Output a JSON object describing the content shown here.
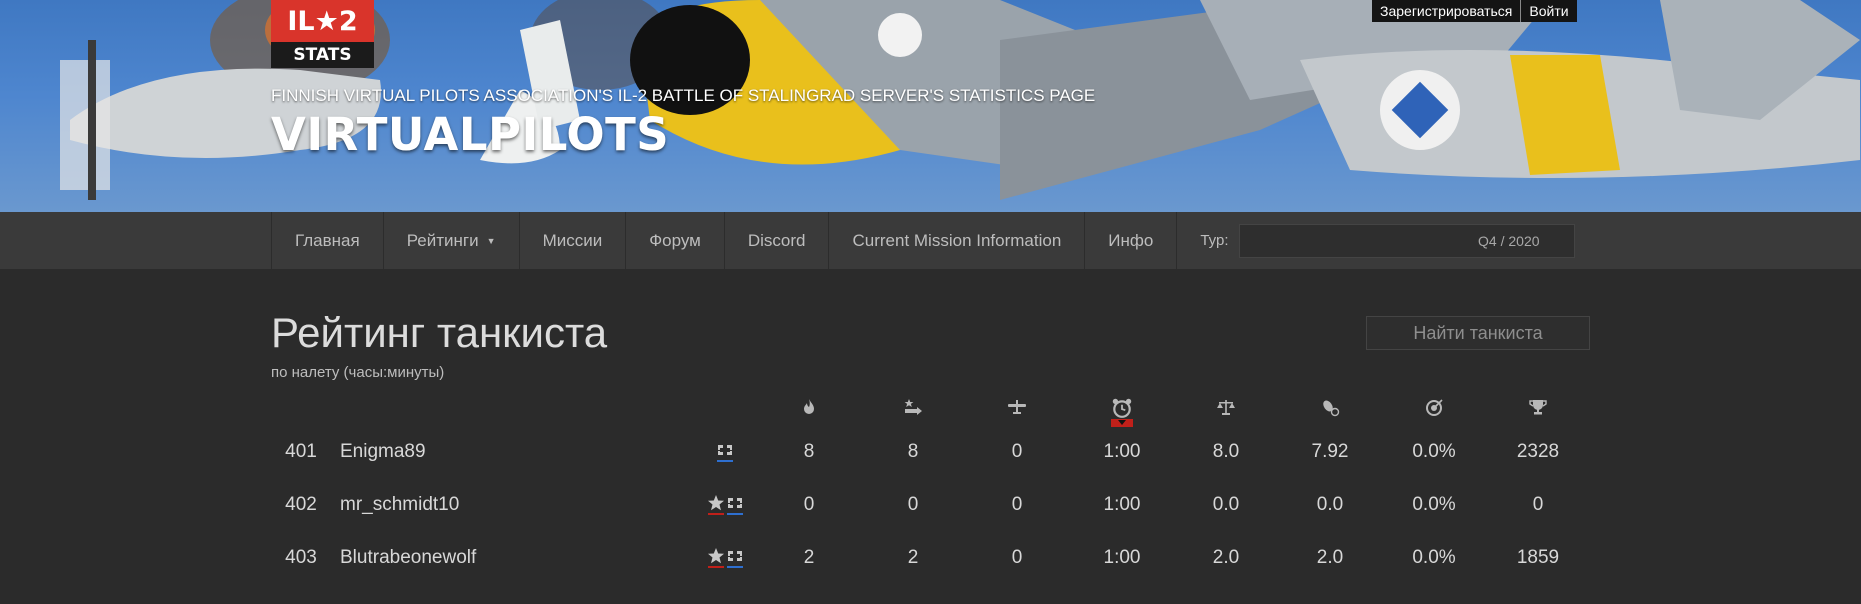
{
  "logo": {
    "line1": "IL★2",
    "line2": "STATS"
  },
  "banner": {
    "subtitle": "FINNISH VIRTUAL PILOTS ASSOCIATION'S IL-2 BATTLE OF STALINGRAD SERVER'S STATISTICS PAGE",
    "title": "VIRTUALPILOTS"
  },
  "auth": {
    "register": "Зарегистрироваться",
    "login": "Войти"
  },
  "nav": {
    "items": [
      "Главная",
      "Рейтинги",
      "Миссии",
      "Форум",
      "Discord",
      "Current Mission Information",
      "Инфо"
    ],
    "tour_label": "Тур:",
    "tour_value": "Q4 / 2020"
  },
  "page": {
    "title": "Рейтинг танкиста",
    "subtitle": "по налету (часы:минуты)",
    "search_placeholder": "Найти танкиста"
  },
  "columns": [
    {
      "icon": "fire-icon"
    },
    {
      "icon": "ground-kill-icon"
    },
    {
      "icon": "plane-icon"
    },
    {
      "icon": "alarm-clock-icon",
      "active": true
    },
    {
      "icon": "scales-icon"
    },
    {
      "icon": "bomb-icon"
    },
    {
      "icon": "target-icon"
    },
    {
      "icon": "trophy-icon"
    }
  ],
  "rows": [
    {
      "rank": "401",
      "name": "Enigma89",
      "flags": [
        "blue"
      ],
      "values": [
        "8",
        "8",
        "0",
        "1:00",
        "8.0",
        "7.92",
        "0.0%",
        "2328"
      ]
    },
    {
      "rank": "402",
      "name": "mr_schmidt10",
      "flags": [
        "red",
        "blue"
      ],
      "values": [
        "0",
        "0",
        "0",
        "1:00",
        "0.0",
        "0.0",
        "0.0%",
        "0"
      ]
    },
    {
      "rank": "403",
      "name": "Blutrabeonewolf",
      "flags": [
        "red",
        "blue"
      ],
      "values": [
        "2",
        "2",
        "0",
        "1:00",
        "2.0",
        "2.0",
        "0.0%",
        "1859"
      ]
    }
  ],
  "colors": {
    "accent_red": "#c0201a",
    "allied_red": "#c0201a",
    "axis_blue": "#2e6fd0",
    "logo_red": "#d9342b"
  }
}
